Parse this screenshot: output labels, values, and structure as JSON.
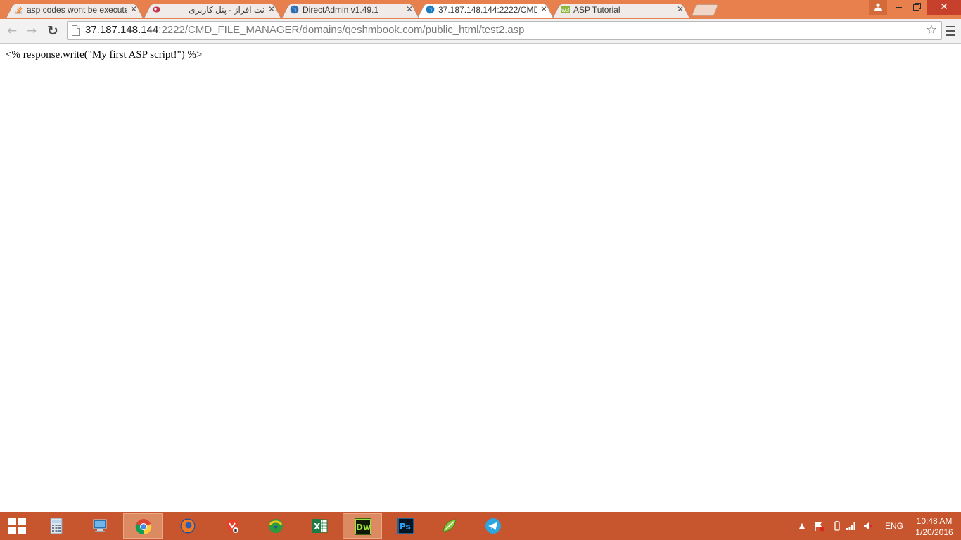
{
  "browser": {
    "tabs": [
      {
        "title": "asp codes wont be executed",
        "favicon": "stackoverflow-icon",
        "active": false
      },
      {
        "title": "نت افراز - پنل کاربری",
        "favicon": "netafraz-icon",
        "active": false,
        "rtl": true
      },
      {
        "title": "DirectAdmin v1.49.1",
        "favicon": "globe-icon",
        "active": false
      },
      {
        "title": "37.187.148.144:2222/CMD",
        "favicon": "globe-icon",
        "active": true
      },
      {
        "title": "ASP Tutorial",
        "favicon": "w3schools-icon",
        "active": false
      }
    ],
    "url_host": "37.187.148.144",
    "url_rest": ":2222/CMD_FILE_MANAGER/domains/qeshmbook.com/public_html/test2.asp"
  },
  "page": {
    "text": "<% response.write(\"My first ASP script!\") %>"
  },
  "taskbar": {
    "apps": [
      "calculator-icon",
      "this-pc-icon",
      "chrome-icon",
      "firefox-icon",
      "brave-icon",
      "download-manager-icon",
      "excel-icon",
      "dreamweaver-icon",
      "photoshop-icon",
      "coreldraw-icon",
      "telegram-icon"
    ],
    "excel_glyph": "X",
    "dreamweaver_glyph": "Dw",
    "photoshop_glyph": "Ps",
    "language": "ENG",
    "time": "10:48 AM",
    "date": "1/20/2016"
  },
  "colors": {
    "titlebar": "#e8804e",
    "taskbar": "#c7552e",
    "close_button": "#c6402c"
  }
}
